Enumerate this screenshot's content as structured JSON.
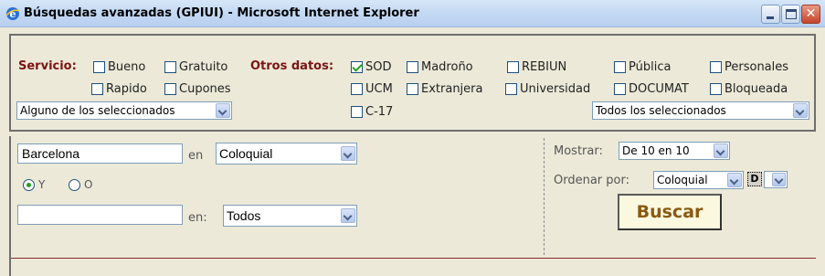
{
  "window": {
    "title": "Búsquedas avanzadas (GPIUI) - Microsoft Internet Explorer"
  },
  "filters": {
    "servicio_label": "Servicio:",
    "otros_label": "Otros datos:",
    "servicio_options": [
      {
        "label": "Bueno",
        "checked": false
      },
      {
        "label": "Gratuito",
        "checked": false
      },
      {
        "label": "Rapido",
        "checked": false
      },
      {
        "label": "Cupones",
        "checked": false
      }
    ],
    "otros_options": [
      {
        "label": "SOD",
        "checked": true
      },
      {
        "label": "Madroño",
        "checked": false
      },
      {
        "label": "REBIUN",
        "checked": false
      },
      {
        "label": "Pública",
        "checked": false
      },
      {
        "label": "Personales",
        "checked": false
      },
      {
        "label": "UCM",
        "checked": false
      },
      {
        "label": "Extranjera",
        "checked": false
      },
      {
        "label": "Universidad",
        "checked": false
      },
      {
        "label": "DOCUMAT",
        "checked": false
      },
      {
        "label": "Bloqueada",
        "checked": false
      },
      {
        "label": "C-17",
        "checked": false
      }
    ],
    "servicio_mode": "Alguno de los seleccionados",
    "otros_mode": "Todos los seleccionados"
  },
  "search": {
    "term1": "Barcelona",
    "en1_label": "en",
    "field1": "Coloquial",
    "radio_y": "Y",
    "radio_o": "O",
    "selected_radio": "Y",
    "term2": "",
    "en2_label": "en:",
    "field2": "Todos"
  },
  "options": {
    "mostrar_label": "Mostrar:",
    "mostrar_value": "De 10 en 10",
    "ordenar_label": "Ordenar por:",
    "ordenar_value": "Coloquial",
    "order_dir": "D",
    "buscar_label": "Buscar"
  }
}
